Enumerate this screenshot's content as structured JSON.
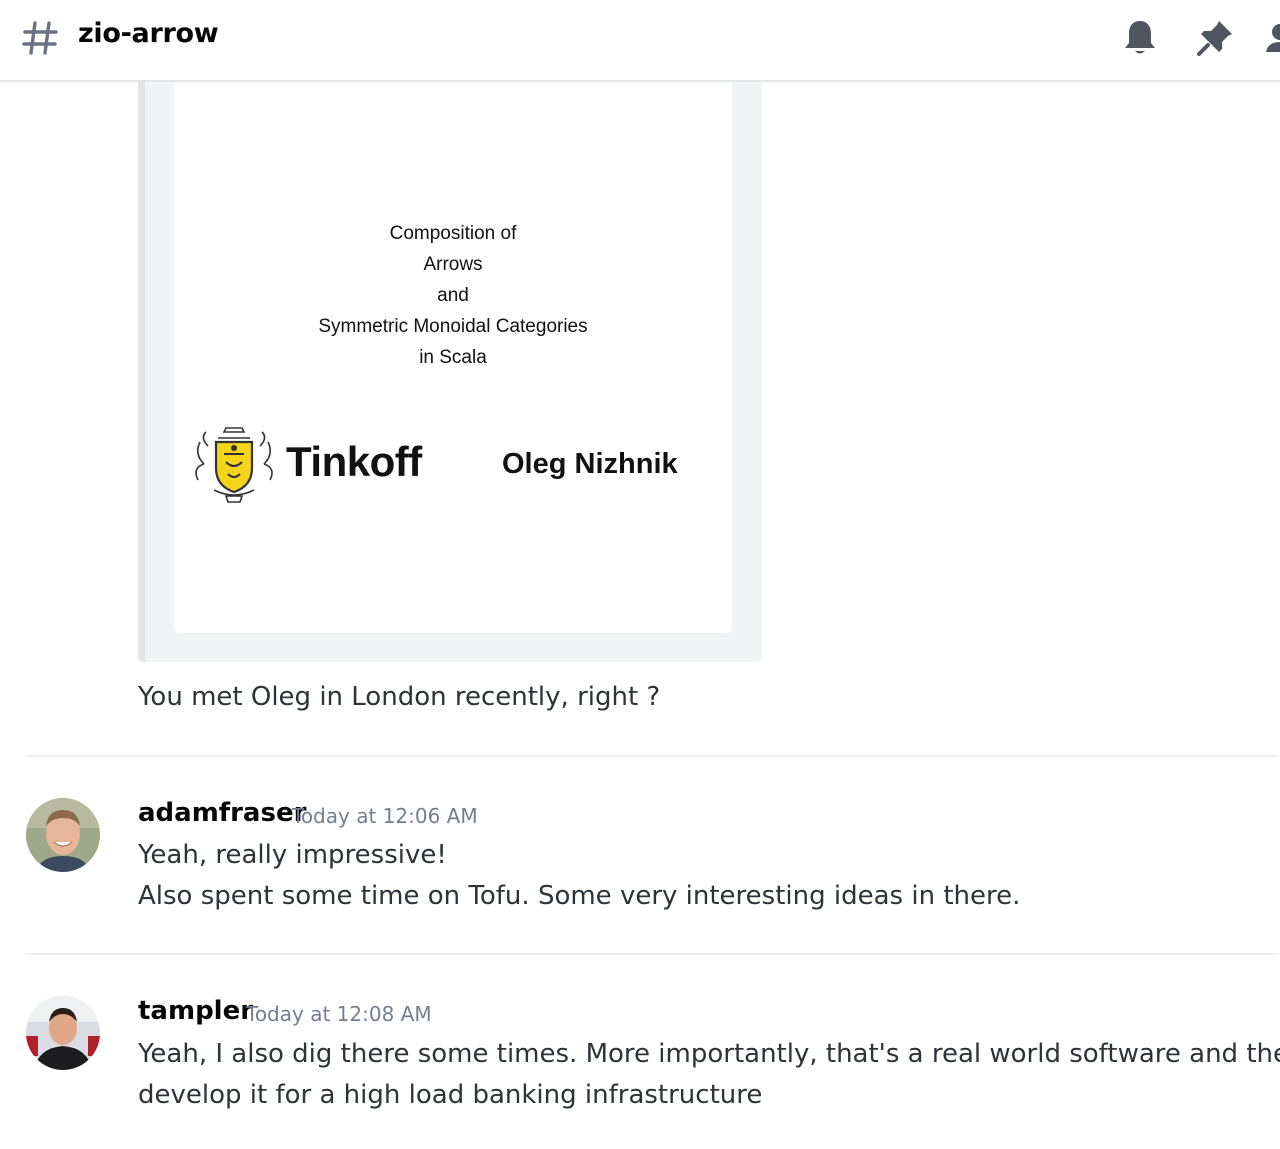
{
  "header": {
    "channel_name": "zio-arrow",
    "icons": [
      "hashtag-icon",
      "bell-icon",
      "pin-icon",
      "members-icon"
    ]
  },
  "embed": {
    "slide_title_lines": [
      "Composition of",
      "Arrows",
      "and",
      "Symmetric Monoidal Categories",
      "in Scala"
    ],
    "logo_text": "Tinkoff",
    "author": "Oleg Nizhnik",
    "logo_colors": {
      "shield": "#f5d51a",
      "outline": "#333333"
    }
  },
  "messages": [
    {
      "text_lines": [
        "You met Oleg in London recently, right ?"
      ]
    },
    {
      "username": "adamfraser",
      "timestamp": "Today at 12:06 AM",
      "text_lines": [
        "Yeah, really impressive!",
        "Also spent some time on Tofu. Some very interesting ideas in there."
      ]
    },
    {
      "username": "tampler",
      "timestamp": "Today at 12:08 AM",
      "text_lines": [
        "Yeah, I also dig there some times. More importantly, that's a real world software and they",
        "develop it for a high load banking infrastructure"
      ]
    }
  ]
}
